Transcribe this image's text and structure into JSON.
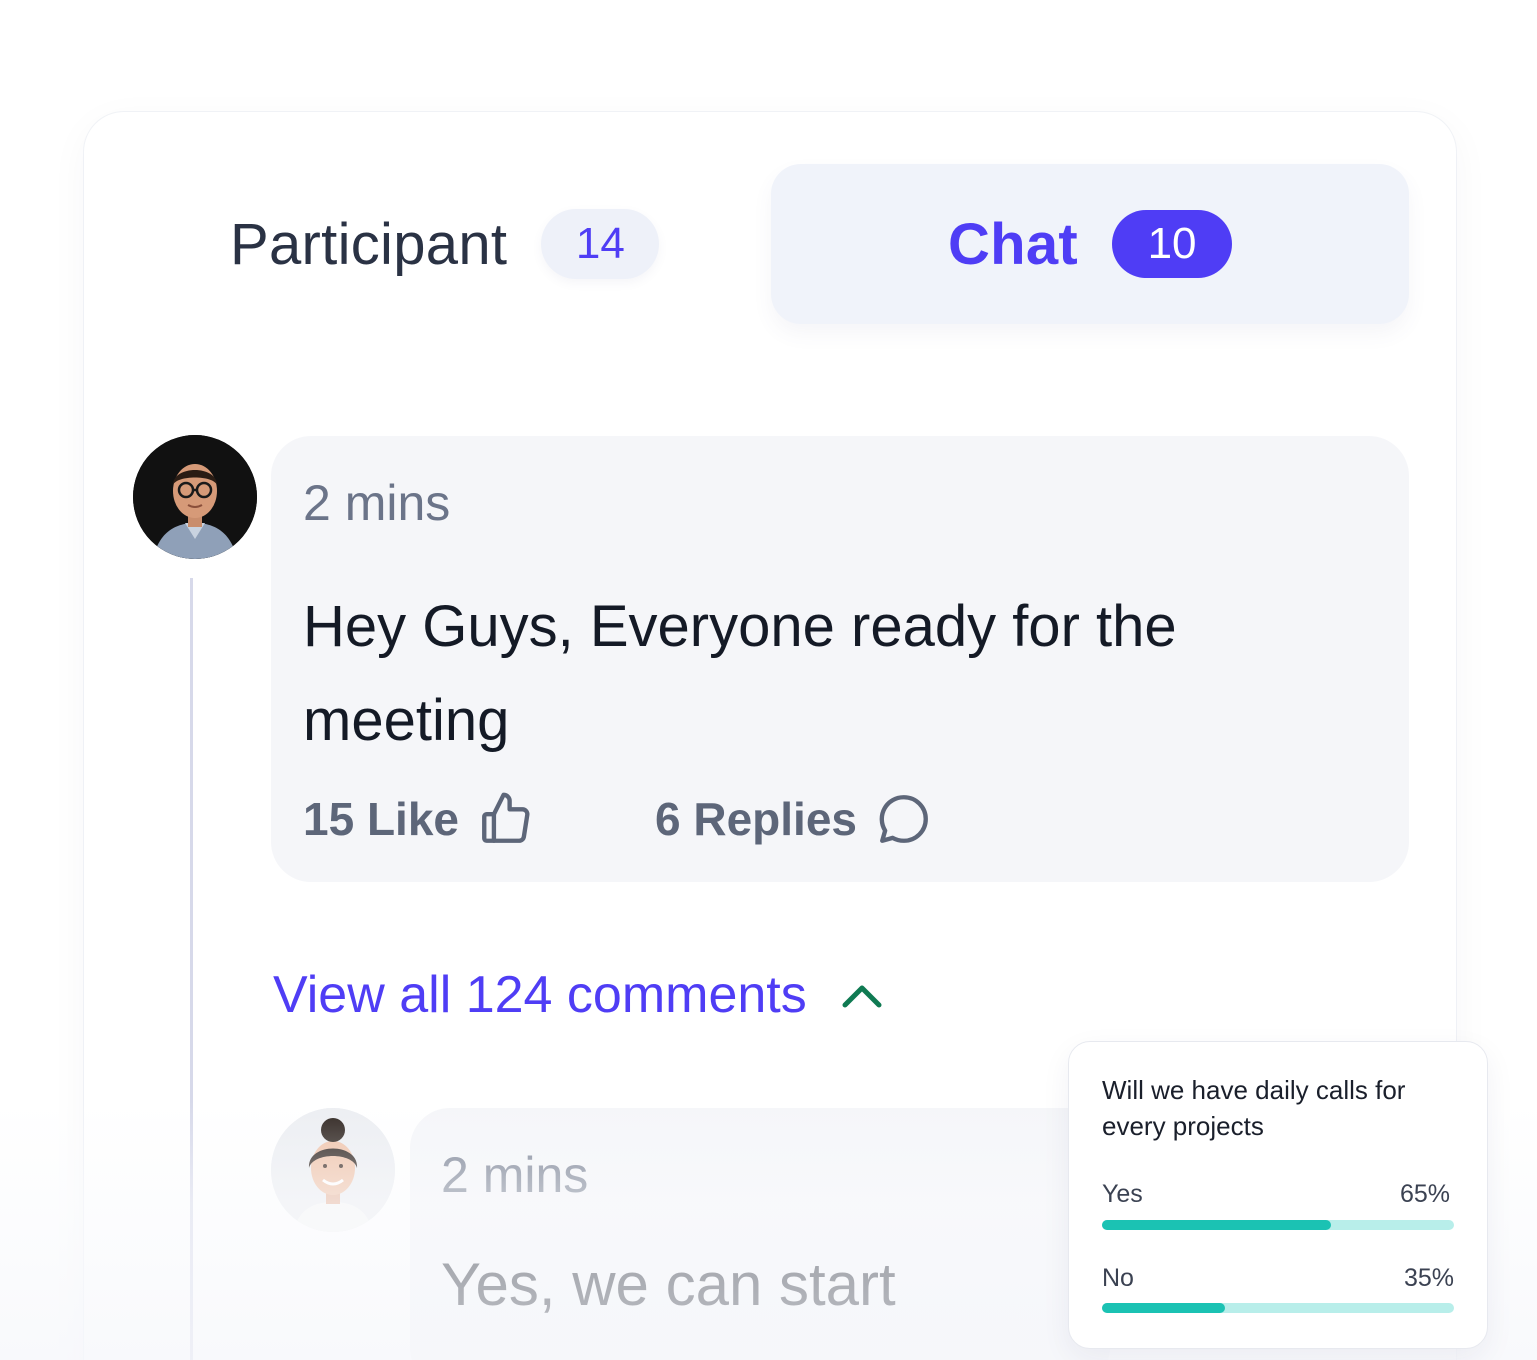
{
  "tabs": {
    "participant": {
      "label": "Participant",
      "count": "14"
    },
    "chat": {
      "label": "Chat",
      "count": "10",
      "active": true
    }
  },
  "colors": {
    "accent": "#4f3df5",
    "poll_fill": "#1bc2b3",
    "poll_track": "#b8eeea",
    "chevron": "#0f7a52"
  },
  "messages": [
    {
      "time": "2 mins",
      "text": "Hey Guys, Everyone ready for the meeting",
      "likes": "15 Like",
      "like_icon": "thumbs-up-icon",
      "replies": "6 Replies",
      "reply_icon": "chat-bubble-icon"
    },
    {
      "time": "2 mins",
      "text": "Yes, we can start"
    }
  ],
  "view_all": {
    "label": "View all 124 comments",
    "icon": "chevron-up-icon"
  },
  "poll": {
    "question": "Will we have daily calls for every projects",
    "options": [
      {
        "label": "Yes",
        "percent_label": "65%",
        "value": 0.65
      },
      {
        "label": "No",
        "percent_label": "35%",
        "value": 0.35
      }
    ]
  }
}
